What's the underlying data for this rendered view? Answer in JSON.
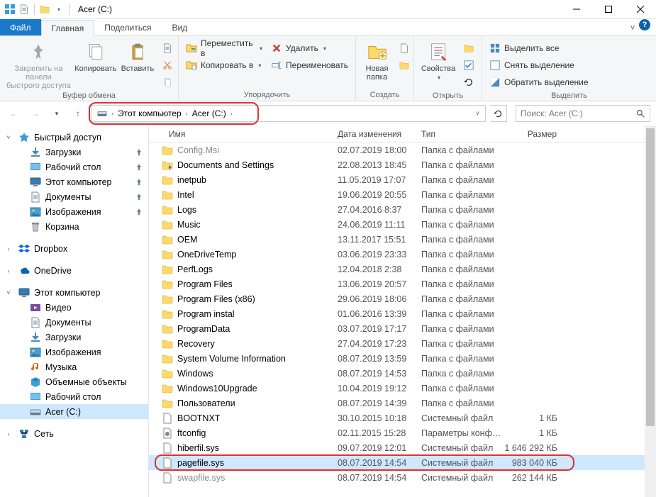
{
  "window": {
    "title": "Acer (C:)"
  },
  "tabs": {
    "file": "Файл",
    "home": "Главная",
    "share": "Поделиться",
    "view": "Вид"
  },
  "ribbon": {
    "pin": "Закрепить на панели\nбыстрого доступа",
    "copy": "Копировать",
    "paste": "Вставить",
    "clipboard_group": "Буфер обмена",
    "move_to": "Переместить в",
    "copy_to": "Копировать в",
    "delete": "Удалить",
    "rename": "Переименовать",
    "organize_group": "Упорядочить",
    "new_folder": "Новая\nпапка",
    "create_group": "Создать",
    "properties": "Свойства",
    "open_group": "Открыть",
    "select_all": "Выделить все",
    "select_none": "Снять выделение",
    "invert_selection": "Обратить выделение",
    "select_group": "Выделить"
  },
  "breadcrumb": {
    "this_pc": "Этот компьютер",
    "drive": "Acer (C:)"
  },
  "search": {
    "placeholder": "Поиск: Acer (C:)"
  },
  "sidebar": {
    "quick_access": "Быстрый доступ",
    "downloads": "Загрузки",
    "desktop": "Рабочий стол",
    "this_pc_q": "Этот компьютер",
    "documents": "Документы",
    "pictures": "Изображения",
    "recycle": "Корзина",
    "dropbox": "Dropbox",
    "onedrive": "OneDrive",
    "this_pc": "Этот компьютер",
    "videos": "Видео",
    "documents2": "Документы",
    "downloads2": "Загрузки",
    "pictures2": "Изображения",
    "music": "Музыка",
    "objects3d": "Объемные объекты",
    "desktop2": "Рабочий стол",
    "acer_c": "Acer (C:)",
    "network": "Сеть"
  },
  "columns": {
    "name": "Имя",
    "date": "Дата изменения",
    "type": "Тип",
    "size": "Размер"
  },
  "files": [
    {
      "name": "Config.Msi",
      "date": "02.07.2019 18:00",
      "type": "Папка с файлами",
      "size": "",
      "icon": "folder",
      "faded": true
    },
    {
      "name": "Documents and Settings",
      "date": "22.08.2013 18:45",
      "type": "Папка с файлами",
      "size": "",
      "icon": "folder-link"
    },
    {
      "name": "inetpub",
      "date": "11.05.2019 17:07",
      "type": "Папка с файлами",
      "size": "",
      "icon": "folder"
    },
    {
      "name": "Intel",
      "date": "19.06.2019 20:55",
      "type": "Папка с файлами",
      "size": "",
      "icon": "folder"
    },
    {
      "name": "Logs",
      "date": "27.04.2016 8:37",
      "type": "Папка с файлами",
      "size": "",
      "icon": "folder"
    },
    {
      "name": "Music",
      "date": "24.06.2019 11:11",
      "type": "Папка с файлами",
      "size": "",
      "icon": "folder"
    },
    {
      "name": "OEM",
      "date": "13.11.2017 15:51",
      "type": "Папка с файлами",
      "size": "",
      "icon": "folder"
    },
    {
      "name": "OneDriveTemp",
      "date": "03.06.2019 23:33",
      "type": "Папка с файлами",
      "size": "",
      "icon": "folder"
    },
    {
      "name": "PerfLogs",
      "date": "12.04.2018 2:38",
      "type": "Папка с файлами",
      "size": "",
      "icon": "folder"
    },
    {
      "name": "Program Files",
      "date": "13.06.2019 20:57",
      "type": "Папка с файлами",
      "size": "",
      "icon": "folder"
    },
    {
      "name": "Program Files (x86)",
      "date": "29.06.2019 18:06",
      "type": "Папка с файлами",
      "size": "",
      "icon": "folder"
    },
    {
      "name": "Program instal",
      "date": "01.06.2016 13:39",
      "type": "Папка с файлами",
      "size": "",
      "icon": "folder"
    },
    {
      "name": "ProgramData",
      "date": "03.07.2019 17:17",
      "type": "Папка с файлами",
      "size": "",
      "icon": "folder"
    },
    {
      "name": "Recovery",
      "date": "27.04.2019 17:23",
      "type": "Папка с файлами",
      "size": "",
      "icon": "folder"
    },
    {
      "name": "System Volume Information",
      "date": "08.07.2019 13:59",
      "type": "Папка с файлами",
      "size": "",
      "icon": "folder"
    },
    {
      "name": "Windows",
      "date": "08.07.2019 14:53",
      "type": "Папка с файлами",
      "size": "",
      "icon": "folder"
    },
    {
      "name": "Windows10Upgrade",
      "date": "10.04.2019 19:12",
      "type": "Папка с файлами",
      "size": "",
      "icon": "folder"
    },
    {
      "name": "Пользователи",
      "date": "08.07.2019 14:39",
      "type": "Папка с файлами",
      "size": "",
      "icon": "folder"
    },
    {
      "name": "BOOTNXT",
      "date": "30.10.2015 10:18",
      "type": "Системный файл",
      "size": "1 КБ",
      "icon": "file"
    },
    {
      "name": "ftconfig",
      "date": "02.11.2015 15:28",
      "type": "Параметры конф…",
      "size": "1 КБ",
      "icon": "file-ini"
    },
    {
      "name": "hiberfil.sys",
      "date": "09.07.2019 12:01",
      "type": "Системный файл",
      "size": "1 646 292 КБ",
      "icon": "file"
    },
    {
      "name": "pagefile.sys",
      "date": "08.07.2019 14:54",
      "type": "Системный файл",
      "size": "983 040 КБ",
      "icon": "file",
      "selected": true
    },
    {
      "name": "swapfile.sys",
      "date": "08.07.2019 14:54",
      "type": "Системный файл",
      "size": "262 144 КБ",
      "icon": "file",
      "faded": true
    }
  ]
}
